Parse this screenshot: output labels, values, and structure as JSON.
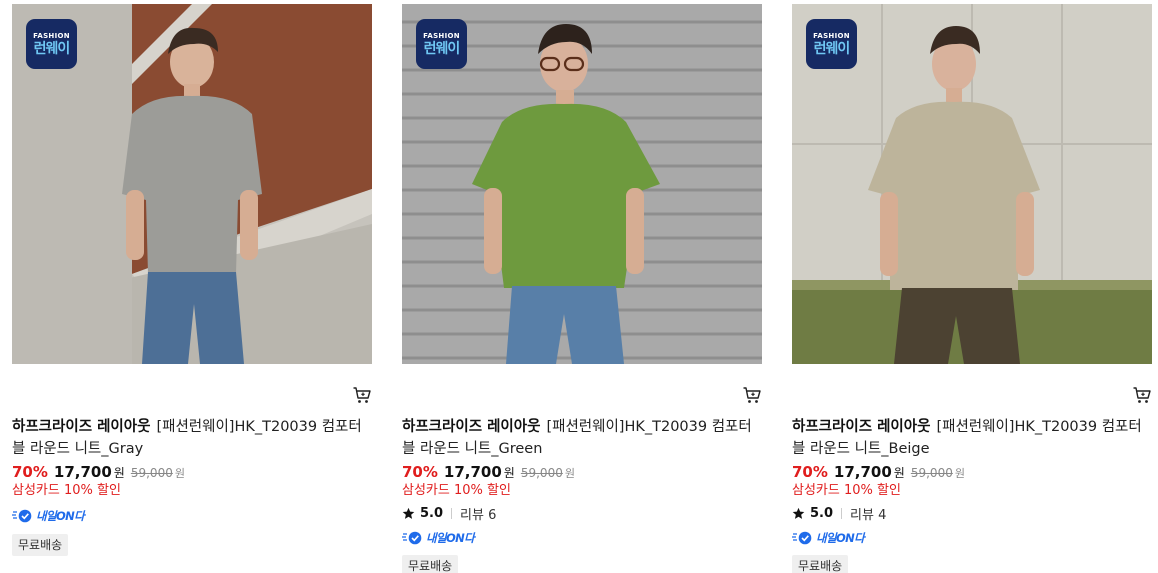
{
  "products": [
    {
      "badge": {
        "top": "FASHION",
        "main": "런웨이"
      },
      "brand": "하프크라이즈 레이아웃",
      "name": "[패션런웨이]HK_T20039 컴포터블 라운드 니트_Gray",
      "discount_rate": "70%",
      "price": "17,700",
      "currency": "원",
      "original_price": "59,000",
      "card_discount": "삼성카드 10% 할인",
      "rating": null,
      "reviews": null,
      "delivery": "내일ON다",
      "shipping": "무료배송",
      "icons": {
        "cart": "cart-icon",
        "delivery": "delivery-truck-icon"
      },
      "colors": {
        "shirt": "#9c9c98",
        "pants": "#4d6f96"
      }
    },
    {
      "badge": {
        "top": "FASHION",
        "main": "런웨이"
      },
      "brand": "하프크라이즈 레이아웃",
      "name": "[패션런웨이]HK_T20039 컴포터블 라운드 니트_Green",
      "discount_rate": "70%",
      "price": "17,700",
      "currency": "원",
      "original_price": "59,000",
      "card_discount": "삼성카드 10% 할인",
      "rating": "5.0",
      "reviews": "리뷰 6",
      "delivery": "내일ON다",
      "shipping": "무료배송",
      "icons": {
        "cart": "cart-icon",
        "star": "star-icon",
        "delivery": "delivery-truck-icon"
      },
      "colors": {
        "shirt": "#6e9a3e",
        "pants": "#587fa8"
      }
    },
    {
      "badge": {
        "top": "FASHION",
        "main": "런웨이"
      },
      "brand": "하프크라이즈 레이아웃",
      "name": "[패션런웨이]HK_T20039 컴포터블 라운드 니트_Beige",
      "discount_rate": "70%",
      "price": "17,700",
      "currency": "원",
      "original_price": "59,000",
      "card_discount": "삼성카드 10% 할인",
      "rating": "5.0",
      "reviews": "리뷰 4",
      "delivery": "내일ON다",
      "shipping": "무료배송",
      "icons": {
        "cart": "cart-icon",
        "star": "star-icon",
        "delivery": "delivery-truck-icon"
      },
      "colors": {
        "shirt": "#bdb49b",
        "pants": "#4c4232"
      }
    }
  ],
  "theme": {
    "accent_red": "#e01e1e",
    "delivery_blue": "#1f6bea",
    "badge_navy": "#162a63"
  }
}
